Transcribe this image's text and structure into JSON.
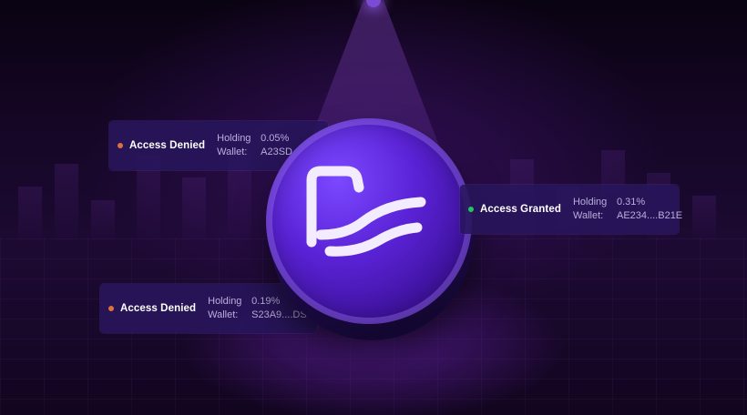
{
  "cards": [
    {
      "status": "Access Denied",
      "holding_label": "Holding",
      "holding_value": "0.05%",
      "wallet_label": "Wallet:",
      "wallet_value": "A23SD....B",
      "dot_color": "#e0703c"
    },
    {
      "status": "Access Granted",
      "holding_label": "Holding",
      "holding_value": "0.31%",
      "wallet_label": "Wallet:",
      "wallet_value": "AE234....B21E",
      "dot_color": "#22c55e"
    },
    {
      "status": "Access Denied",
      "holding_label": "Holding",
      "holding_value": "0.19%",
      "wallet_label": "Wallet:",
      "wallet_value": "S23A9....DS",
      "dot_color": "#e0703c"
    }
  ],
  "coin": {
    "icon": "wave-logo-icon",
    "color": "#5a22d6"
  }
}
